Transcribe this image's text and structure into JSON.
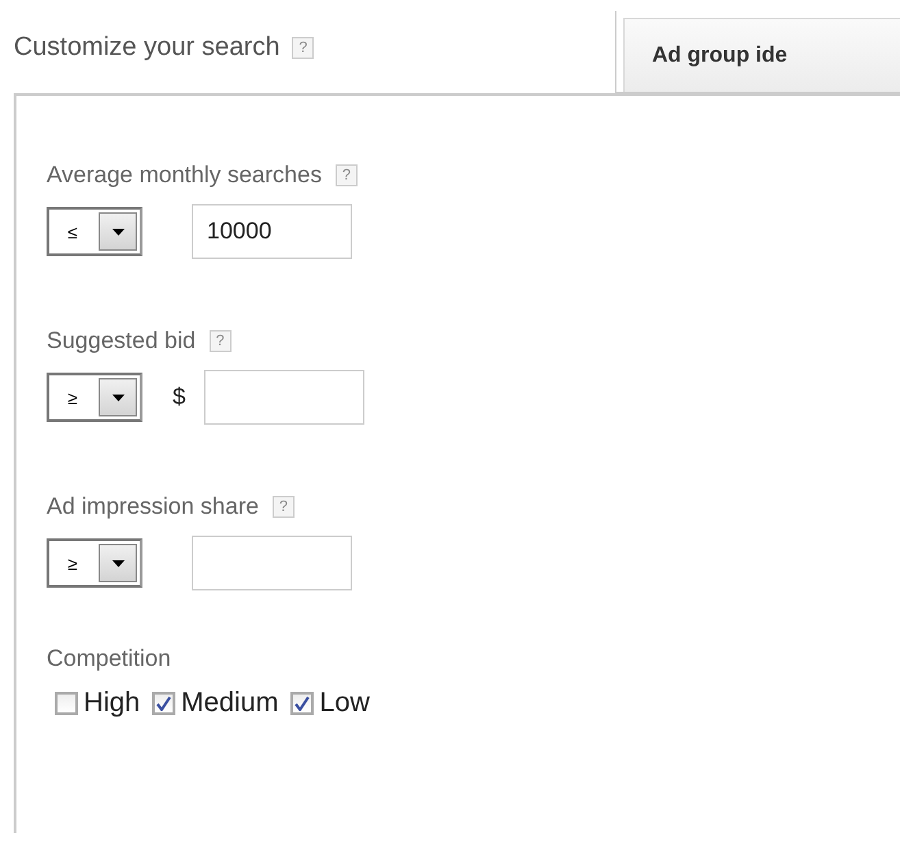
{
  "header": {
    "title": "Customize your search",
    "help": "?"
  },
  "tab": {
    "label": "Ad group ide",
    "selected": true
  },
  "filters": [
    {
      "label": "Average monthly searches",
      "help": "?",
      "operator": "≤",
      "value": "10000"
    },
    {
      "label": "Suggested bid",
      "help": "?",
      "operator": "≥",
      "prefix": "$"
    },
    {
      "label": "Ad impression share",
      "help": "?",
      "operator": "≥"
    }
  ],
  "competition": {
    "label": "Competition",
    "options": [
      {
        "label": "High",
        "checked": false
      },
      {
        "label": "Medium",
        "checked": true
      },
      {
        "label": "Low",
        "checked": true
      }
    ]
  }
}
